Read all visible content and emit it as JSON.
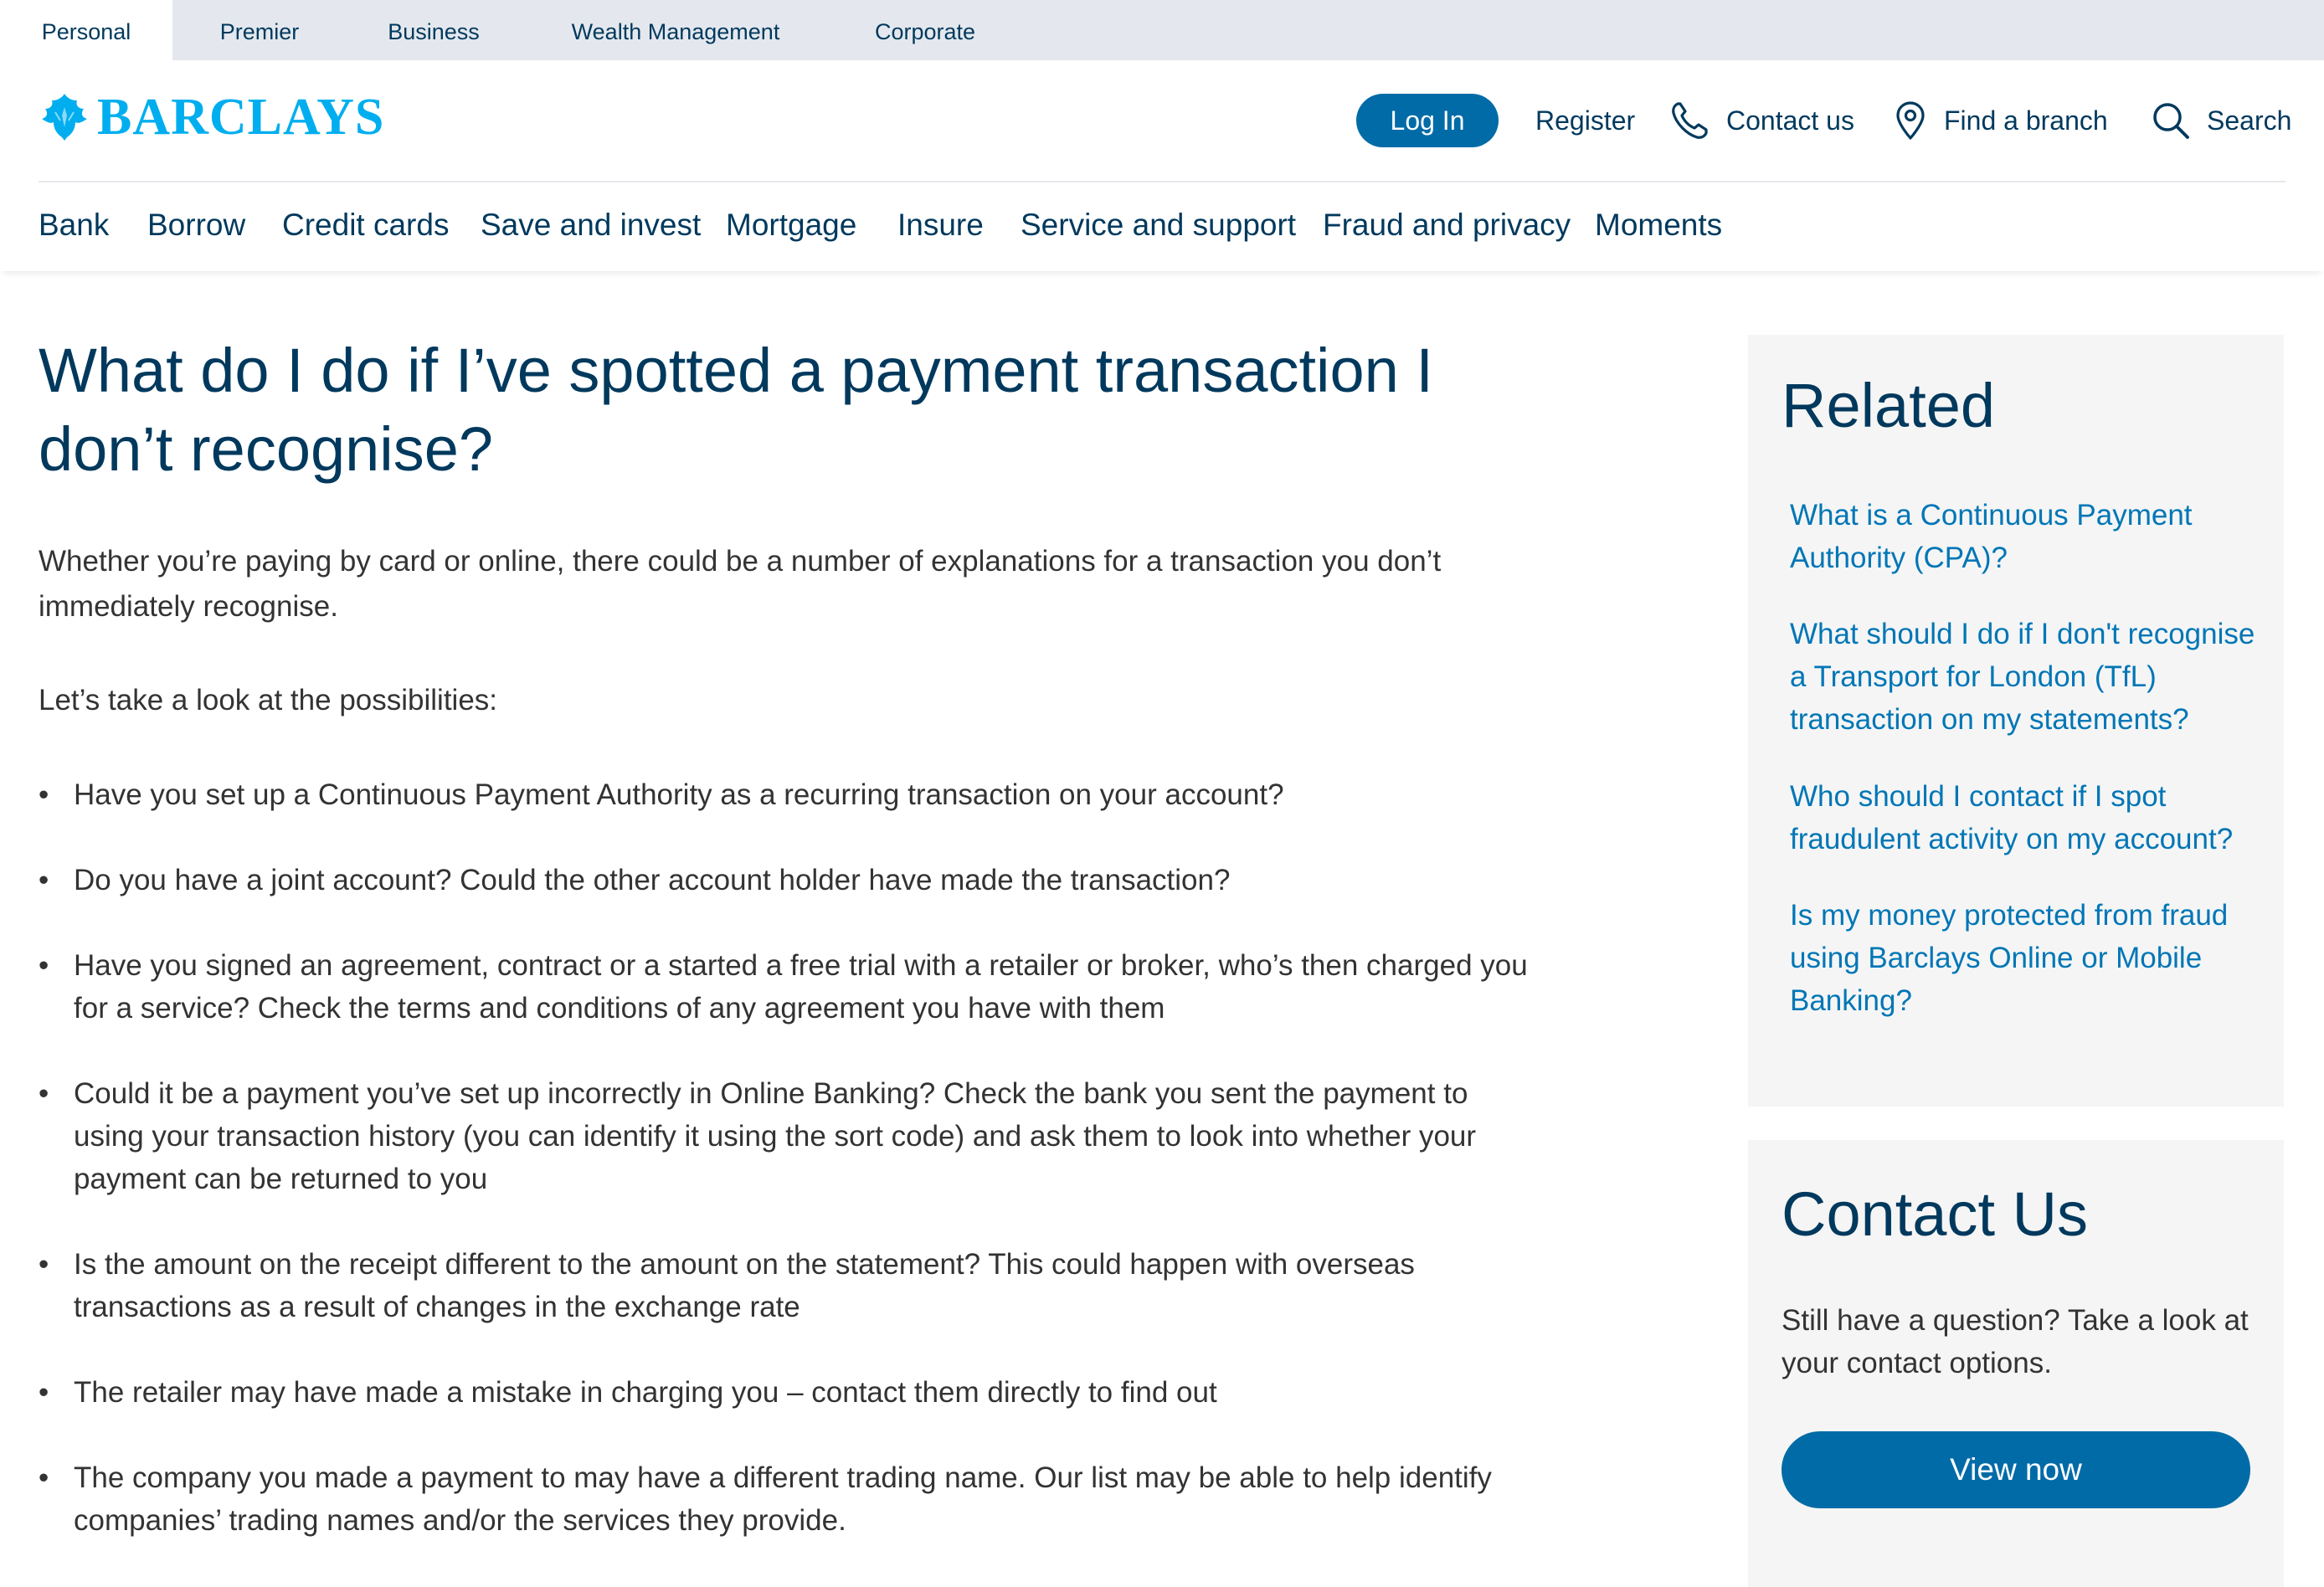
{
  "segments": [
    {
      "label": "Personal",
      "active": true
    },
    {
      "label": "Premier",
      "active": false
    },
    {
      "label": "Business",
      "active": false
    },
    {
      "label": "Wealth Management",
      "active": false
    },
    {
      "label": "Corporate",
      "active": false
    }
  ],
  "header": {
    "logo_text": "BARCLAYS",
    "login_label": "Log In",
    "register_label": "Register",
    "contact_label": "Contact us",
    "branch_label": "Find a branch",
    "search_label": "Search"
  },
  "nav": [
    "Bank",
    "Borrow",
    "Credit cards",
    "Save and invest",
    "Mortgage",
    "Insure",
    "Service and support",
    "Fraud and privacy",
    "Moments"
  ],
  "article": {
    "title": "What do I do if I’ve spotted a payment transaction I don’t recognise?",
    "intro": "Whether you’re paying by card or online, there could be a number of explanations for a transaction you don’t immediately recognise.",
    "lead": "Let’s take a look at the possibilities:",
    "bullets": [
      "Have you set up a Continuous Payment Authority as a recurring transaction on your account?",
      "Do you have a joint account? Could the other account holder have made the transaction?",
      "Have you signed an agreement, contract or a started a free trial with a retailer or broker, who’s then charged you for a service? Check the terms and conditions of any agreement you have with them",
      "Could it be a payment you’ve set up incorrectly in Online Banking? Check the bank you sent the payment to using your transaction history (you can identify it using the sort code) and ask them to look into whether your payment can be returned to you",
      "Is the amount on the receipt different to the amount on the statement? This could happen with overseas transactions as a result of changes in the exchange rate",
      "The retailer may have made a mistake in charging you – contact them directly to find out",
      "The company you made a payment to may have a different trading name. Our list may be able to help identify companies’ trading names and/or the services they provide."
    ]
  },
  "related": {
    "title": "Related",
    "links": [
      "What is a Continuous Payment Authority (CPA)?",
      "What should I do if I don't recognise a Transport for London (TfL) transaction on my statements?",
      "Who should I contact if I spot fraudulent activity on my account?",
      "Is my money protected from fraud using Barclays Online or Mobile Banking?"
    ]
  },
  "contact": {
    "title": "Contact Us",
    "text": "Still have a question? Take a look at your contact options.",
    "button_label": "View now"
  },
  "colors": {
    "navy": "#00395d",
    "brand_blue": "#00aeef",
    "button_blue": "#006ba7",
    "link_blue": "#0076b6",
    "segment_bar": "#e4e8ee",
    "panel_bg": "#f5f5f5"
  },
  "icons": {
    "logo": "barclays-eagle-icon",
    "contact": "phone-icon",
    "branch": "map-pin-icon",
    "search": "search-icon"
  }
}
